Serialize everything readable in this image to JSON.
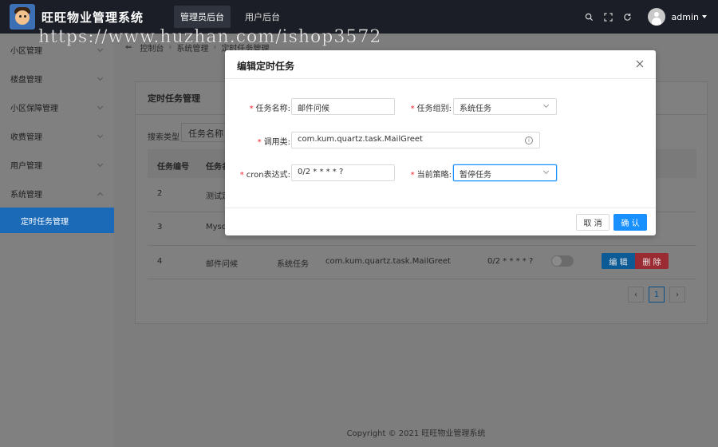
{
  "header": {
    "app_title": "旺旺物业管理系统",
    "nav": [
      "管理员后台",
      "用户后台"
    ],
    "user": "admin"
  },
  "watermark": "https://www.huzhan.com/ishop3572",
  "sidebar": {
    "items": [
      "小区管理",
      "楼盘管理",
      "小区保障管理",
      "收费管理",
      "用户管理",
      "系统管理"
    ],
    "sub_active": "定时任务管理"
  },
  "breadcrumb": [
    "控制台",
    "系统管理",
    "定时任务管理"
  ],
  "card": {
    "title": "定时任务管理",
    "search_label": "搜索类型",
    "search_value": "任务名称",
    "columns": [
      "任务编号",
      "任务名"
    ],
    "rows": [
      {
        "id": "2",
        "name": "测试定"
      },
      {
        "id": "3",
        "name": "Mysq"
      },
      {
        "id": "4",
        "name": "邮件问候",
        "group": "系统任务",
        "class": "com.kum.quartz.task.MailGreet",
        "cron": "0/2 * * * * ?"
      }
    ],
    "edit_label": "编 辑",
    "delete_label": "删 除",
    "page": "1"
  },
  "footer": "Copyright © 2021 旺旺物业管理系统",
  "modal": {
    "title": "编辑定时任务",
    "task_name_label": "任务名称:",
    "task_name_value": "邮件问候",
    "task_group_label": "任务组别:",
    "task_group_value": "系统任务",
    "invoke_label": "调用类:",
    "invoke_value": "com.kum.quartz.task.MailGreet",
    "cron_label": "cron表达式:",
    "cron_value": "0/2 * * * * ?",
    "policy_label": "当前策略:",
    "policy_value": "暂停任务",
    "cancel_label": "取 消",
    "ok_label": "确 认"
  }
}
